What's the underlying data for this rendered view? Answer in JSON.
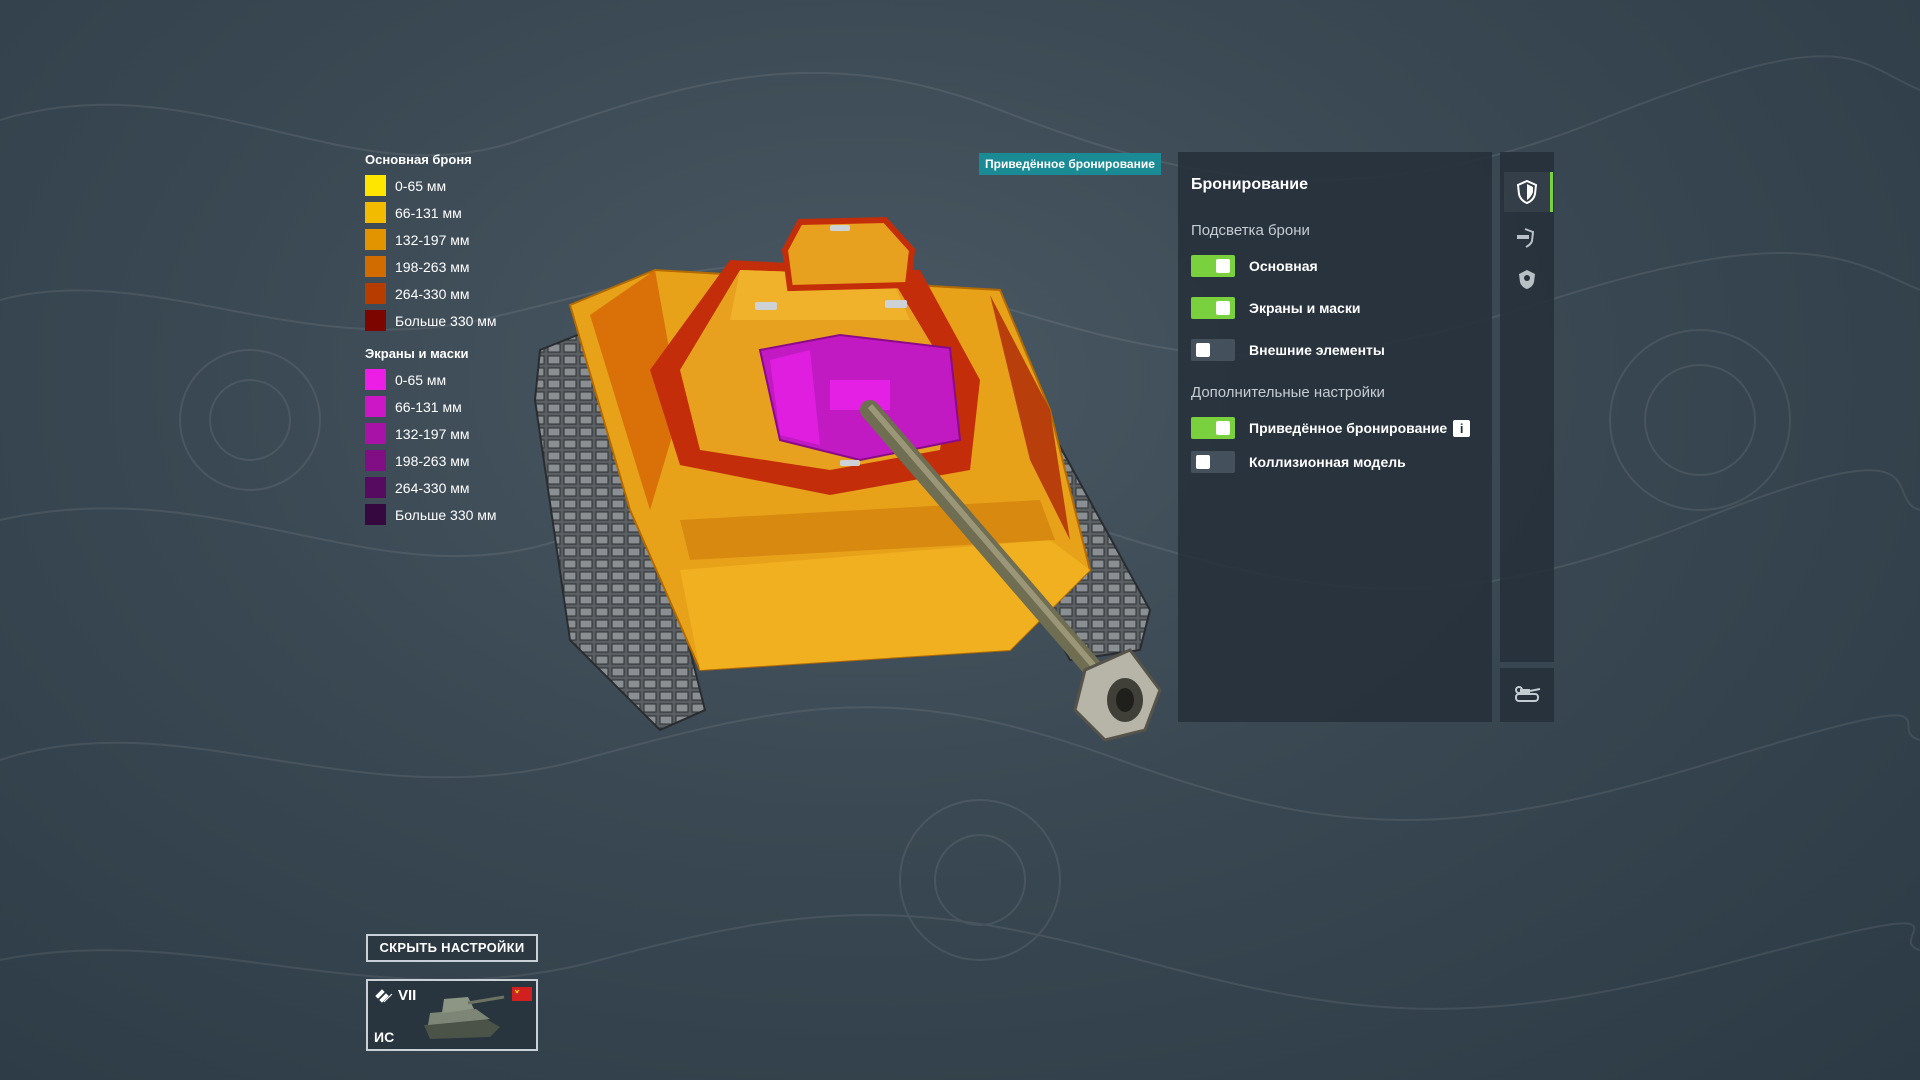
{
  "legend": {
    "main_title": "Основная броня",
    "main_items": [
      {
        "label": "0-65 мм",
        "color": "#ffe600"
      },
      {
        "label": "66-131 мм",
        "color": "#f2bb00"
      },
      {
        "label": "132-197 мм",
        "color": "#e19400"
      },
      {
        "label": "198-263 мм",
        "color": "#d06c00"
      },
      {
        "label": "264-330 мм",
        "color": "#b73c00"
      },
      {
        "label": "Больше 330 мм",
        "color": "#7c0500"
      }
    ],
    "screens_title": "Экраны и маски",
    "screens_items": [
      {
        "label": "0-65 мм",
        "color": "#ec1ee6"
      },
      {
        "label": "66-131 мм",
        "color": "#cc17c6"
      },
      {
        "label": "132-197 мм",
        "color": "#a812a6"
      },
      {
        "label": "198-263 мм",
        "color": "#820e85"
      },
      {
        "label": "264-330 мм",
        "color": "#560b60"
      },
      {
        "label": "Больше 330 мм",
        "color": "#360840"
      }
    ]
  },
  "badge": "Приведённое бронирование",
  "panel": {
    "title": "Бронирование",
    "section1": "Подсветка брони",
    "opt_main": "Основная",
    "opt_screens": "Экраны и маски",
    "opt_external": "Внешние элементы",
    "section2": "Дополнительные настройки",
    "opt_effective": "Приведённое бронирование",
    "info": "i",
    "opt_collision": "Коллизионная модель"
  },
  "toggles": {
    "main": true,
    "screens": true,
    "external": false,
    "effective": true,
    "collision": false
  },
  "icons": {
    "tab1": "armor-shield-icon",
    "tab2": "shell-penetration-icon",
    "tab3": "crew-icon",
    "bottom": "vehicle-settings-icon"
  },
  "bottom": {
    "hide_button": "СКРЫТЬ НАСТРОЙКИ",
    "tier": "VII",
    "vehicle_name": "ИС",
    "flag_color": "#d21f1f"
  },
  "colors": {
    "accent_green": "#7ad13e",
    "badge_teal": "#1a8a95"
  }
}
